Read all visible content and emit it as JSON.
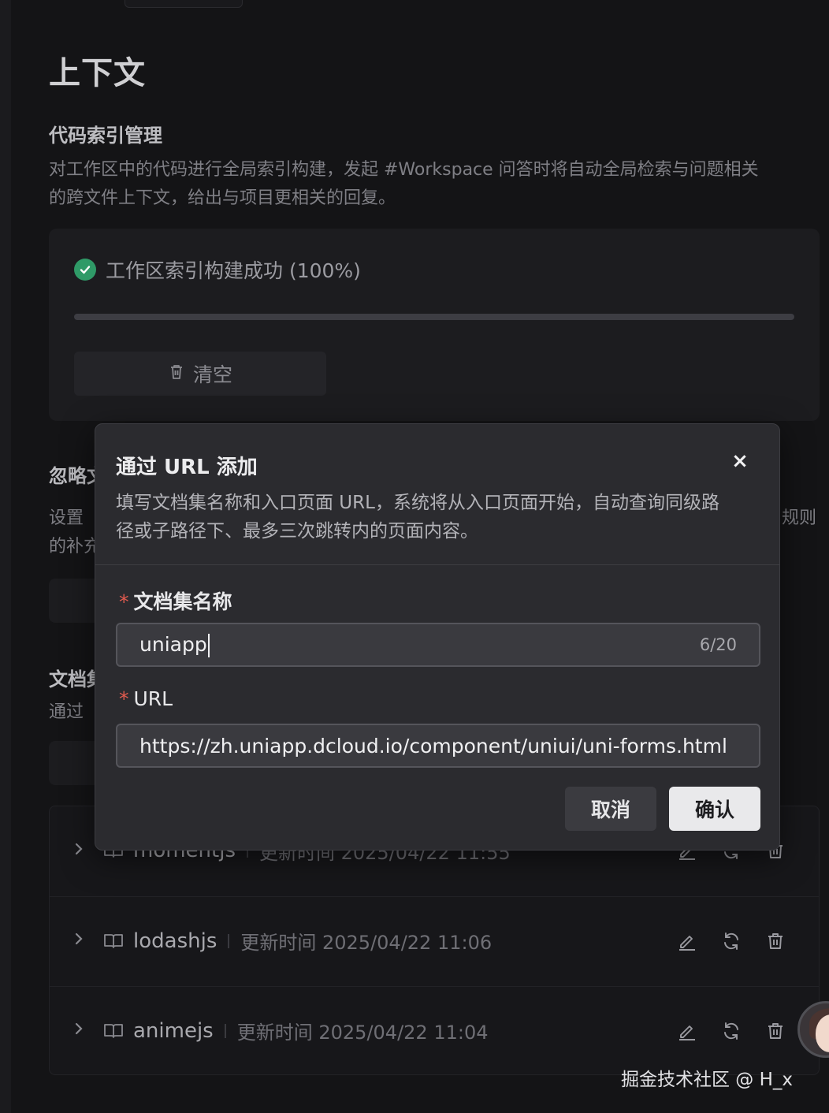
{
  "page": {
    "title": "上下文",
    "code_index": {
      "heading": "代码索引管理",
      "description_line1": "对工作区中的代码进行全局索引构建，发起 #Workspace 问答时将自动全局检索与问题相关",
      "description_line2": "的跨文件上下文，给出与项目更相关的回复。",
      "status_text": "工作区索引构建成功 (100%)",
      "progress_percent": 100,
      "clear_label": "清空"
    },
    "ignore_section": {
      "heading_partial": "忽略文",
      "desc_partial_line1": "设置",
      "desc_partial_line2": "的补充",
      "desc_right_fragment": "规则"
    },
    "docs_section": {
      "heading_partial": "文档集",
      "desc_partial": "通过"
    },
    "doc_sets": [
      {
        "name": "momentjs",
        "time_label": "更新时间 2025/04/22 11:55"
      },
      {
        "name": "lodashjs",
        "time_label": "更新时间 2025/04/22 11:06"
      },
      {
        "name": "animejs",
        "time_label": "更新时间 2025/04/22 11:04"
      }
    ]
  },
  "modal": {
    "title": "通过 URL 添加",
    "close_glyph": "×",
    "description_line1": "填写文档集名称和入口页面 URL，系统将从入口页面开始，自动查询同级路",
    "description_line2": "径或子路径下、最多三次跳转内的页面内容。",
    "name_field": {
      "required_mark": "*",
      "label": "文档集名称",
      "value": "uniapp",
      "counter": "6/20"
    },
    "url_field": {
      "required_mark": "*",
      "label": "URL",
      "value": "https://zh.uniapp.dcloud.io/component/uniui/uni-forms.html"
    },
    "cancel_label": "取消",
    "confirm_label": "确认"
  },
  "watermark": "掘金技术社区 @ H_x"
}
